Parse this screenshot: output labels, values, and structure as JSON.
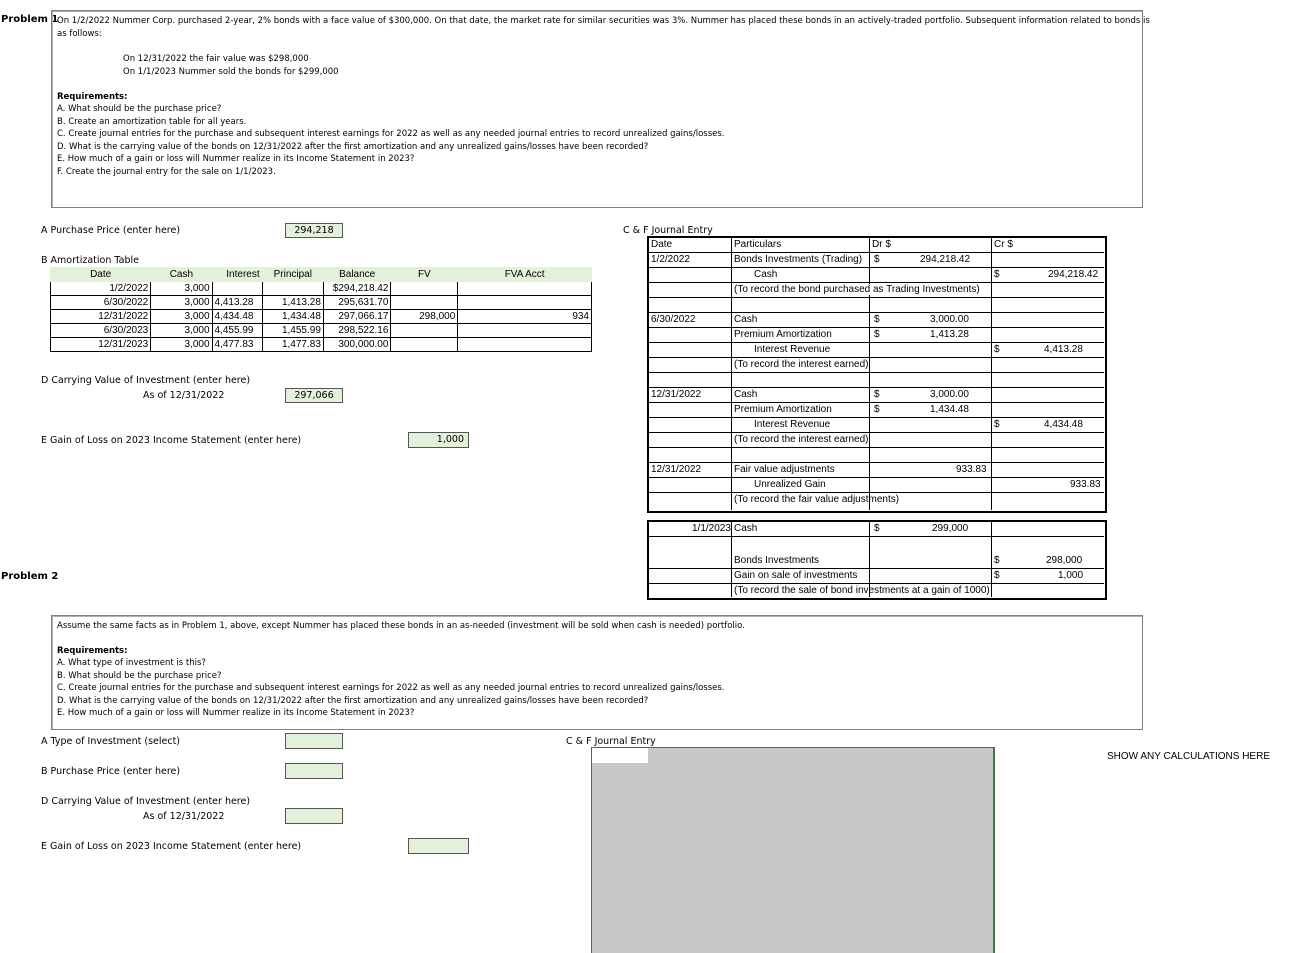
{
  "p1": {
    "label": "Problem 1",
    "intro": "On 1/2/2022 Nummer Corp. purchased 2-year, 2% bonds with a face value of $300,000.   On that date, the market rate for similar securities was 3%.  Nummer has placed these bonds in an actively-traded portfolio.  Subsequent information related to bonds is",
    "intro2": "as follows:",
    "fact1": "On 12/31/2022 the fair value was $298,000",
    "fact2": "On 1/1/2023 Nummer sold the bonds for $299,000",
    "req_title": "Requirements:",
    "reqs": [
      "A. What should be the purchase price?",
      "B. Create an amortization table for all years.",
      "C. Create journal entries for the purchase and subsequent interest earnings for 2022 as well as any needed journal entries to record unrealized gains/losses.",
      "D. What is the carrying value of the bonds on 12/31/2022 after the first amortization and any unrealized gains/losses have been recorded?",
      "E. How much of a gain or loss will Nummer realize in its Income Statement in 2023?",
      "F. Create the journal entry for the sale on 1/1/2023."
    ],
    "a_label": "A  Purchase Price (enter here)",
    "a_value": "294,218",
    "b_label": "B  Amortization Table",
    "amort_headers": [
      "Date",
      "Cash",
      "Interest",
      "Principal",
      "Balance",
      "FV",
      "FVA Acct"
    ],
    "amort_rows": [
      [
        "1/2/2022",
        "3,000",
        "",
        "",
        "$294,218.42",
        "",
        ""
      ],
      [
        "6/30/2022",
        "3,000",
        "4,413.28",
        "1,413.28",
        "295,631.70",
        "",
        ""
      ],
      [
        "12/31/2022",
        "3,000",
        "4,434.48",
        "1,434.48",
        "297,066.17",
        "298,000",
        "934"
      ],
      [
        "6/30/2023",
        "3,000",
        "4,455.99",
        "1,455.99",
        "298,522.16",
        "",
        ""
      ],
      [
        "12/31/2023",
        "3,000",
        "4,477.83",
        "1,477.83",
        "300,000.00",
        "",
        ""
      ]
    ],
    "d_label": "D  Carrying Value of Investment (enter here)",
    "d_sub": "As of 12/31/2022",
    "d_value": "297,066",
    "e_label": "E  Gain of Loss on 2023 Income Statement (enter here)",
    "e_value": "1,000",
    "cf_label": "C & F  Journal Entry",
    "j_head": {
      "date": "Date",
      "part": "Particulars",
      "dr": "Dr $",
      "cr": "Cr $"
    },
    "j1": {
      "date": "1/2/2022",
      "l1": "Bonds Investments (Trading)",
      "l1_cur": "$",
      "l1_dr": "294,218.42",
      "l2": "Cash",
      "l2_cur": "$",
      "l2_cr": "294,218.42",
      "note": "(To record the bond purchased as Trading Investments)"
    },
    "j2": {
      "date": "6/30/2022",
      "l1": "Cash",
      "l1_cur": "$",
      "l1_dr": "3,000.00",
      "l2": "Premium Amortization",
      "l2_cur": "$",
      "l2_dr": "1,413.28",
      "l3": "Interest Revenue",
      "l3_cur": "$",
      "l3_cr": "4,413.28",
      "note": "(To record the interest earned)"
    },
    "j3": {
      "date": "12/31/2022",
      "l1": "Cash",
      "l1_cur": "$",
      "l1_dr": "3,000.00",
      "l2": "Premium Amortization",
      "l2_cur": "$",
      "l2_dr": "1,434.48",
      "l3": "Interest Revenue",
      "l3_cur": "$",
      "l3_cr": "4,434.48",
      "note": "(To record the interest earned)"
    },
    "j4": {
      "date": "12/31/2022",
      "l1": "Fair value adjustments",
      "l1_dr": "933.83",
      "l2": "Unrealized Gain",
      "l2_cr": "933.83",
      "note": "(To record the fair value adjustments)"
    },
    "j5": {
      "date": "1/1/2023",
      "l1": "Cash",
      "l1_cur": "$",
      "l1_dr": "299,000",
      "l2": "Bonds Investments",
      "l2_cur": "$",
      "l2_cr": "298,000",
      "l3": "Gain on sale of investments",
      "l3_cur": "$",
      "l3_cr": "1,000",
      "note": "(To record the sale of bond investments at a gain of 1000)"
    }
  },
  "p2": {
    "label": "Problem 2",
    "intro": "Assume the same facts as in Problem 1, above, except Nummer has placed these bonds in an as-needed (investment will be sold when cash is needed) portfolio.",
    "req_title": "Requirements:",
    "reqs": [
      "A. What type of investment is this?",
      "B.  What should be the purchase price?",
      "C. Create journal entries for the purchase and subsequent interest earnings for 2022 as well as any needed journal entries to record unrealized gains/losses.",
      "D. What is the carrying value of the bonds on 12/31/2022 after the first amortization and any unrealized gains/losses have been recorded?",
      "E. How much of a gain or loss will Nummer realize in its Income Statement in 2023?"
    ],
    "a_label": "A  Type of Investment (select)",
    "b_label": "B  Purchase Price (enter here)",
    "d_label": "D  Carrying Value of Investment (enter here)",
    "d_sub": "As of 12/31/2022",
    "e_label": "E  Gain of Loss on 2023 Income Statement (enter here)",
    "cf_label": "C & F  Journal Entry",
    "calc_note": "SHOW ANY CALCULATIONS HERE"
  }
}
